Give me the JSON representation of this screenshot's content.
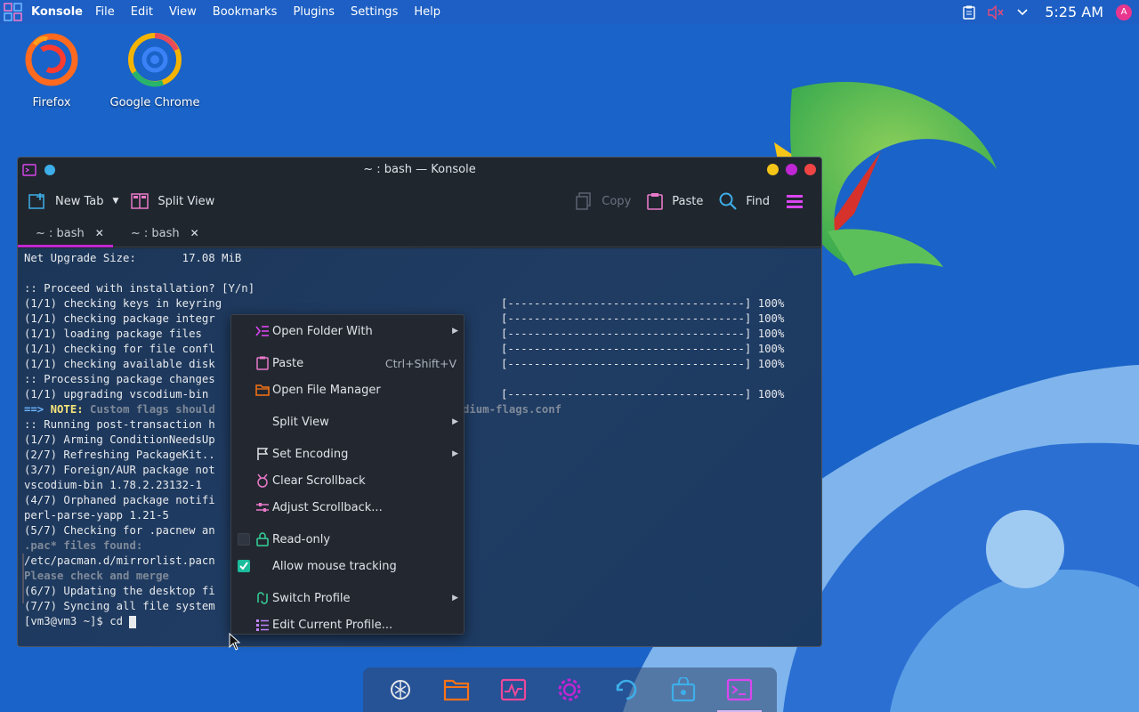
{
  "top_panel": {
    "app_name": "Konsole",
    "menu": [
      "File",
      "Edit",
      "View",
      "Bookmarks",
      "Plugins",
      "Settings",
      "Help"
    ],
    "clock": "5:25 AM",
    "tray_icons": [
      "clipboard-icon",
      "volume-muted-icon",
      "chevron-down-icon"
    ],
    "user_initial": "A"
  },
  "desktop_icons": [
    {
      "label": "Firefox",
      "icon": "firefox-icon"
    },
    {
      "label": "Google Chrome",
      "icon": "chrome-icon"
    }
  ],
  "window": {
    "title": "~ : bash — Konsole",
    "toolbar": {
      "new_tab": "New Tab",
      "split_view": "Split View",
      "copy": "Copy",
      "paste": "Paste",
      "find": "Find"
    },
    "tabs": [
      {
        "label": "~ : bash",
        "active": true
      },
      {
        "label": "~ : bash",
        "active": false
      }
    ]
  },
  "terminal": {
    "lines": [
      "Net Upgrade Size:       17.08 MiB",
      "",
      ":: Proceed with installation? [Y/n]",
      "(1/1) checking keys in keyring",
      "(1/1) checking package integr",
      "(1/1) loading package files",
      "(1/1) checking for file confl",
      "(1/1) checking available disk",
      ":: Processing package changes",
      "(1/1) upgrading vscodium-bin",
      "",
      ":: Running post-transaction h",
      "(1/7) Arming ConditionNeedsUp",
      "(2/7) Refreshing PackageKit..",
      "(3/7) Foreign/AUR package not",
      "vscodium-bin 1.78.2.23132-1",
      "(4/7) Orphaned package notifi",
      "perl-parse-yapp 1.21-5",
      "(5/7) Checking for .pacnew an",
      "",
      "/etc/pacman.d/mirrorlist.pacn",
      "",
      "(6/7) Updating the desktop fi",
      "(7/7) Syncing all file system"
    ],
    "note_prefix": "==> ",
    "note_label": "NOTE:",
    "note_text": " Custom flags should",
    "note_tail": "dium-flags.conf",
    "pac_found": ".pac* files found:",
    "check_merge": "Please check and merge",
    "progress_bar": "[------------------------------------] 100%",
    "prompt": "[vm3@vm3 ~]$ cd "
  },
  "context_menu": {
    "items": [
      {
        "label": "Open Folder With",
        "icon": "open-with-icon",
        "submenu": true
      },
      {
        "label": "Paste",
        "icon": "paste-icon",
        "shortcut": "Ctrl+Shift+V"
      },
      {
        "label": "Open File Manager",
        "icon": "folder-icon"
      },
      {
        "label": "Split View",
        "submenu": true
      },
      {
        "label": "Set Encoding",
        "icon": "flag-icon",
        "submenu": true
      },
      {
        "label": "Clear Scrollback",
        "icon": "clear-icon"
      },
      {
        "label": "Adjust Scrollback...",
        "icon": "adjust-icon"
      },
      {
        "label": "Read-only",
        "icon": "lock-icon",
        "checked": false
      },
      {
        "label": "Allow mouse tracking",
        "checked": true
      },
      {
        "label": "Switch Profile",
        "icon": "switch-profile-icon",
        "submenu": true
      },
      {
        "label": "Edit Current Profile...",
        "icon": "edit-profile-icon"
      }
    ]
  },
  "dock": [
    "launcher-icon",
    "file-manager-icon",
    "system-monitor-icon",
    "settings-icon",
    "updater-icon",
    "store-icon",
    "konsole-icon"
  ],
  "colors": {
    "accent": "#c026d3",
    "desktop_blue": "#1a63c8",
    "checkbox_teal": "#1abc9c"
  }
}
